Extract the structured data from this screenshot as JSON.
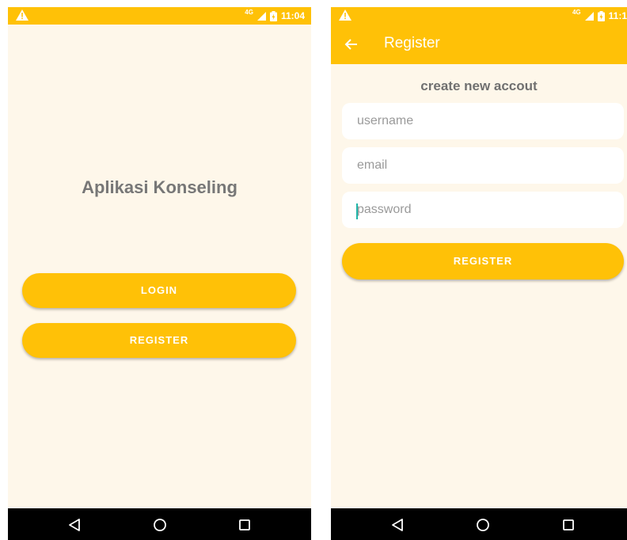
{
  "colors": {
    "accent": "#ffc107",
    "background": "#fef7ea",
    "field_bg": "#ffffff",
    "title_text": "#777777",
    "navbar": "#000000",
    "caret": "#1fb5a8"
  },
  "screen1": {
    "status": {
      "network": "4G",
      "time": "11:04"
    },
    "title": "Aplikasi Konseling",
    "login_label": "LOGIN",
    "register_label": "REGISTER"
  },
  "screen2": {
    "status": {
      "network": "4G",
      "time": "11:1"
    },
    "appbar_title": "Register",
    "heading": "create new accout",
    "username_placeholder": "username",
    "email_placeholder": "email",
    "password_placeholder": "password",
    "register_label": "REGISTER"
  },
  "icons": {
    "warning": "warning-icon",
    "signal": "signal-icon",
    "battery": "battery-icon",
    "back": "back-arrow-icon",
    "nav_back": "nav-back-icon",
    "nav_home": "nav-home-icon",
    "nav_recents": "nav-recents-icon"
  }
}
